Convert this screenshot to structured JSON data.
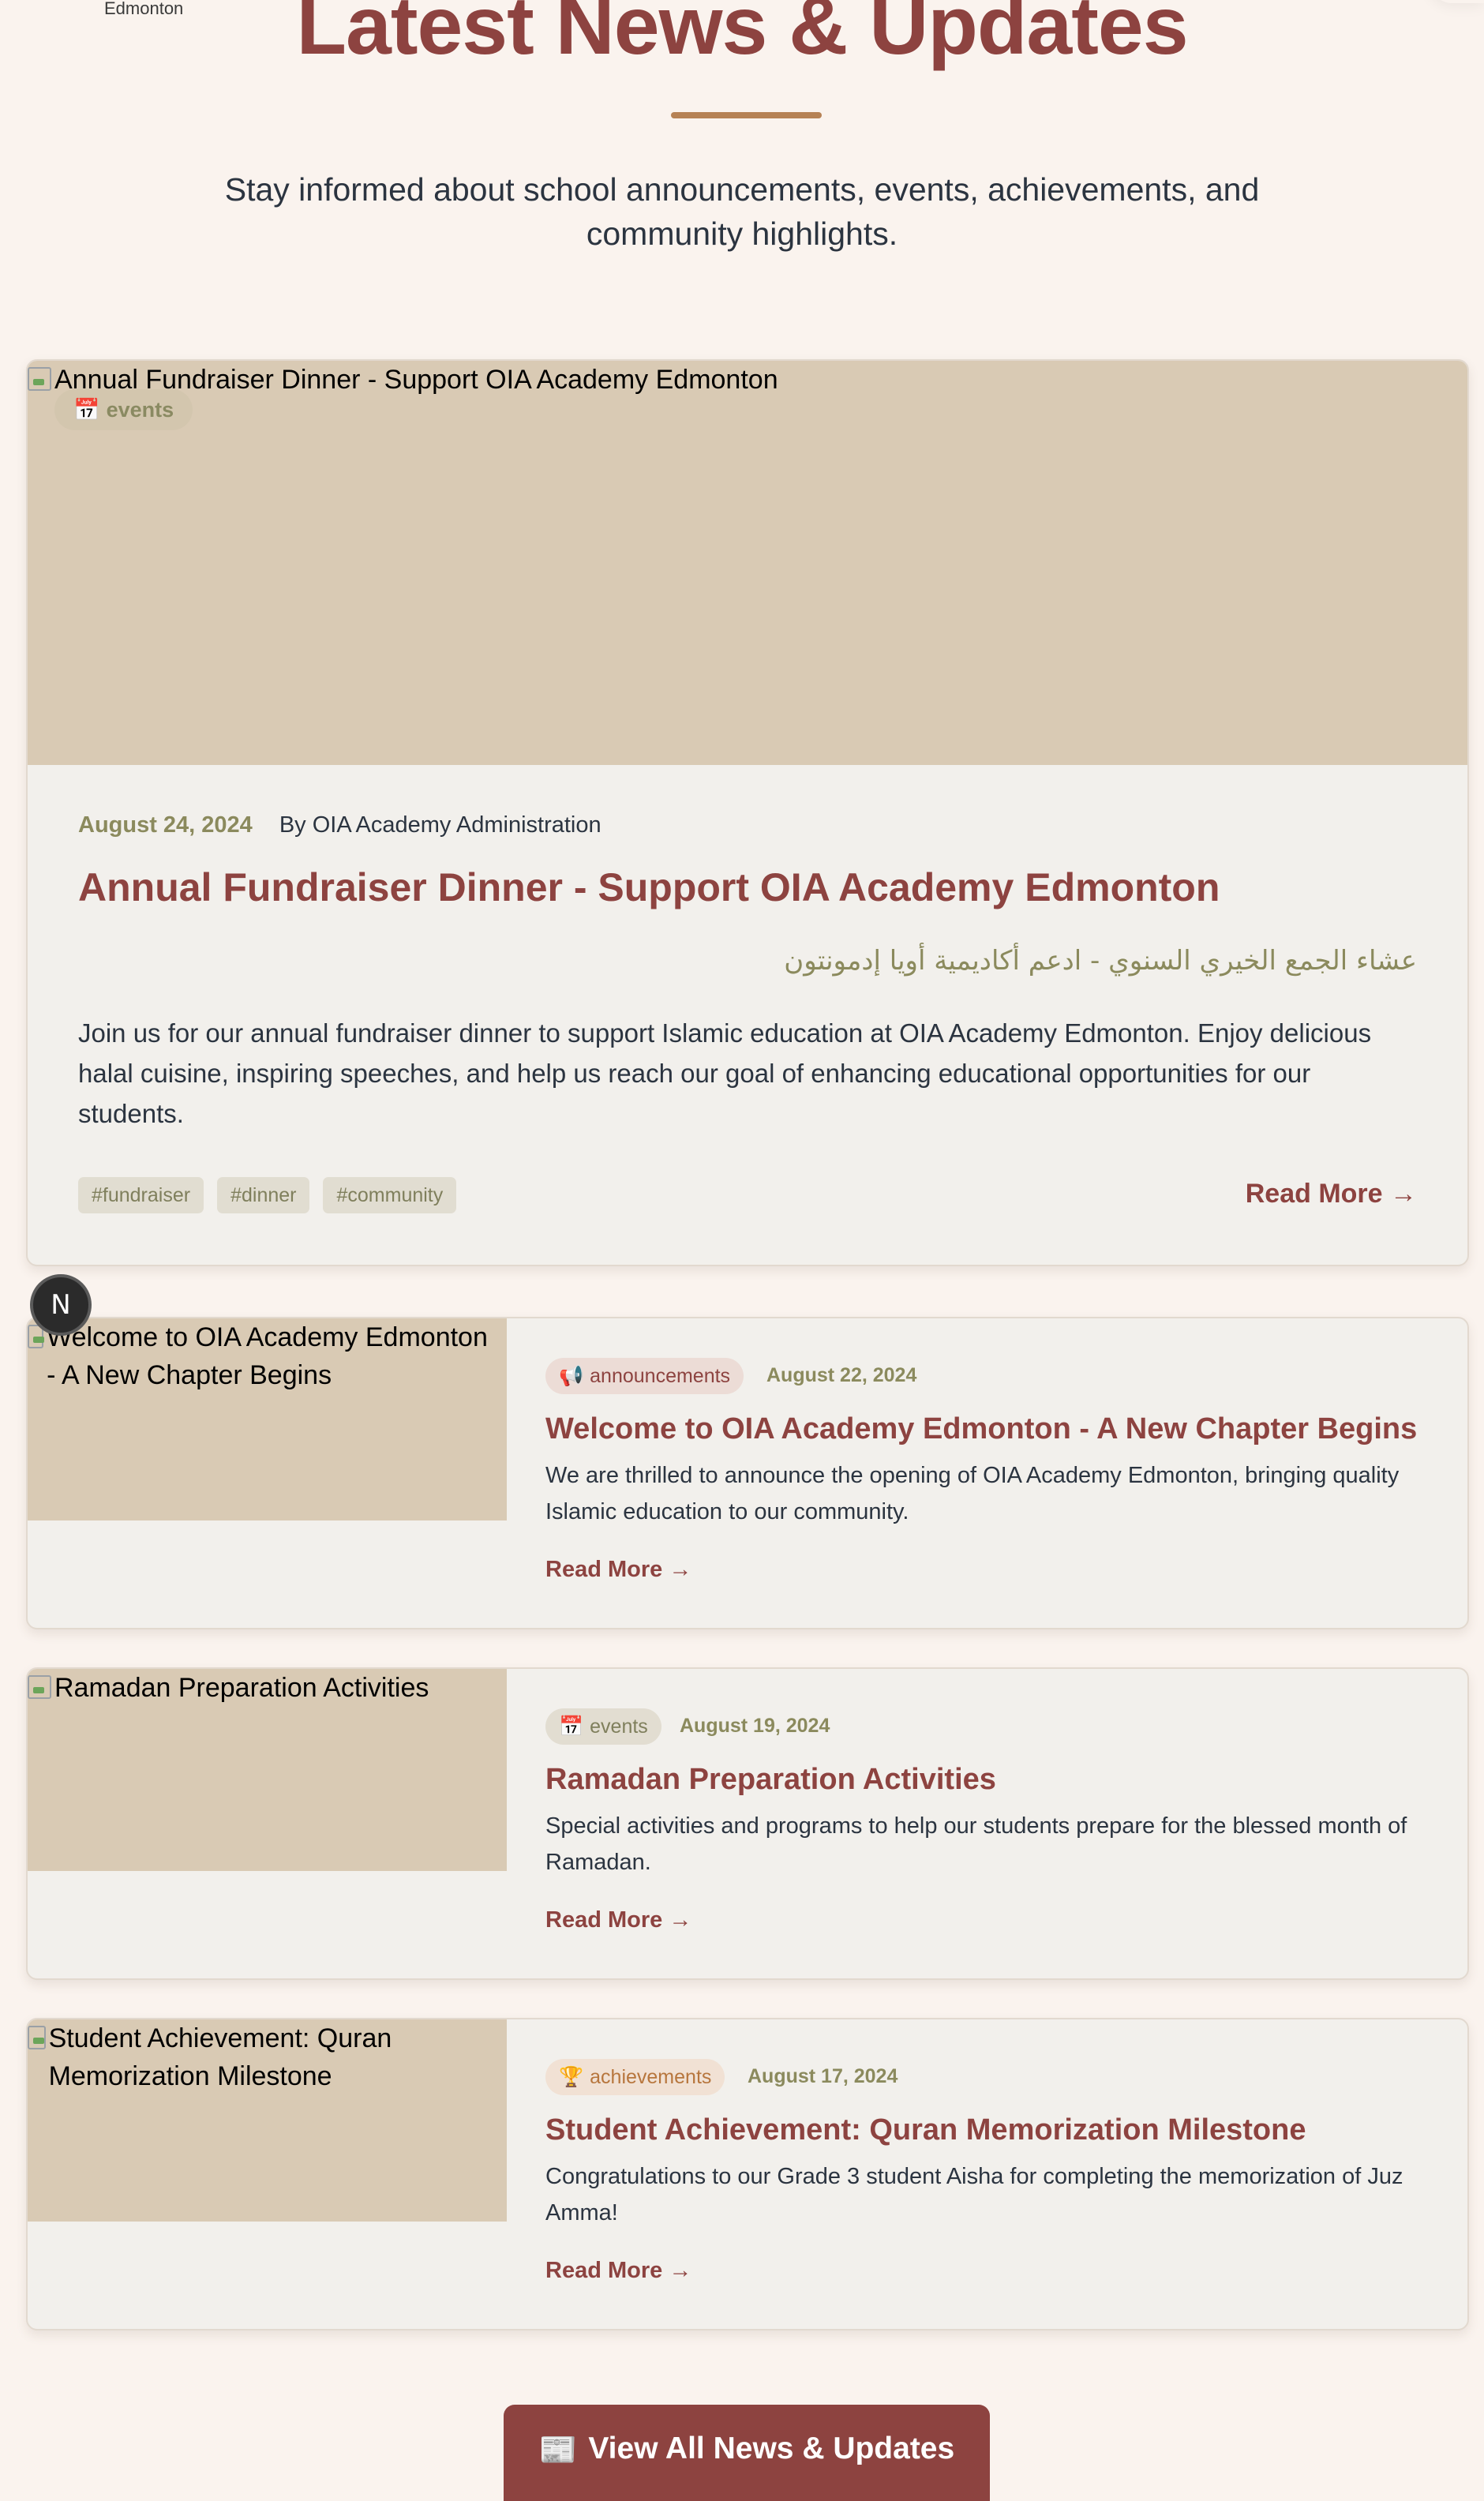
{
  "header": {
    "logo_text": "Edmonton"
  },
  "hero": {
    "title": "Latest News & Updates",
    "subtitle": "Stay informed about school announcements, events, achievements, and community highlights."
  },
  "featured": {
    "image_alt": "Annual Fundraiser Dinner - Support OIA Academy Edmonton",
    "category": "events",
    "category_icon": "📅",
    "date": "August 24, 2024",
    "author": "By OIA Academy Administration",
    "title": "Annual Fundraiser Dinner - Support OIA Academy Edmonton",
    "title_ar": "عشاء الجمع الخيري السنوي - ادعم أكاديمية أويا إدمونتون",
    "body": "Join us for our annual fundraiser dinner to support Islamic education at OIA Academy Edmonton. Enjoy delicious halal cuisine, inspiring speeches, and help us reach our goal of enhancing educational opportunities for our students.",
    "tags": [
      "#fundraiser",
      "#dinner",
      "#community"
    ],
    "read_more": "Read More →"
  },
  "articles": [
    {
      "image_alt": "Welcome to OIA Academy Edmonton - A New Chapter Begins",
      "category": "announcements",
      "category_icon": "📢",
      "date": "August 22, 2024",
      "title": "Welcome to OIA Academy Edmonton - A New Chapter Begins",
      "excerpt": "We are thrilled to announce the opening of OIA Academy Edmonton, bringing quality Islamic education to our community.",
      "read_more": "Read More →"
    },
    {
      "image_alt": "Ramadan Preparation Activities",
      "category": "events",
      "category_icon": "📅",
      "date": "August 19, 2024",
      "title": "Ramadan Preparation Activities",
      "excerpt": "Special activities and programs to help our students prepare for the blessed month of Ramadan.",
      "read_more": "Read More →"
    },
    {
      "image_alt": "Student Achievement: Quran Memorization Milestone",
      "category": "achievements",
      "category_icon": "🏆",
      "date": "August 17, 2024",
      "title": "Student Achievement: Quran Memorization Milestone",
      "excerpt": "Congratulations to our Grade 3 student Aisha for completing the memorization of Juz Amma!",
      "read_more": "Read More →"
    }
  ],
  "floating_button": "N",
  "view_all": {
    "icon": "📰",
    "label": "View All News & Updates"
  },
  "colors": {
    "accent": "#8d4340",
    "gold": "#b68255",
    "olive": "#8b8a5d",
    "image_placeholder": "#d9cab4",
    "page_bg": "#faf3ee"
  }
}
